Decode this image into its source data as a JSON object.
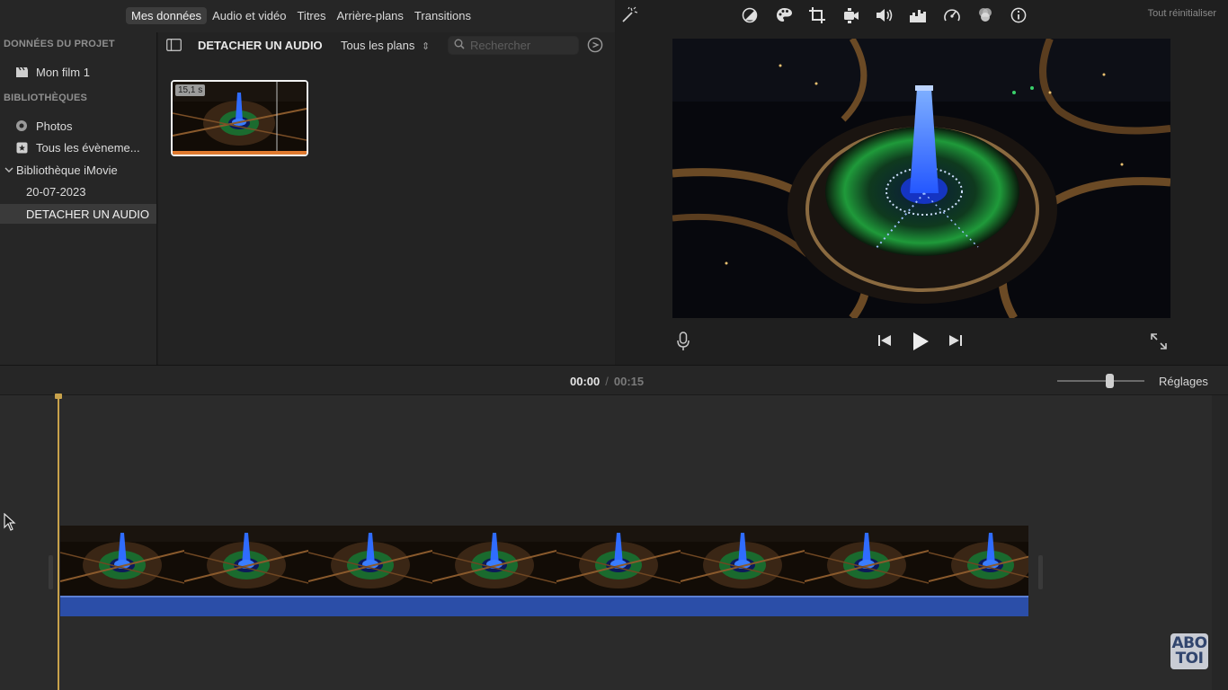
{
  "top_tabs": [
    {
      "label": "Mes données",
      "active": true
    },
    {
      "label": "Audio et vidéo",
      "active": false
    },
    {
      "label": "Titres",
      "active": false
    },
    {
      "label": "Arrière-plans",
      "active": false
    },
    {
      "label": "Transitions",
      "active": false
    }
  ],
  "sidebar": {
    "project_header": "DONNÉES DU PROJET",
    "project_item": {
      "label": "Mon film 1",
      "icon": "clapperboard-icon"
    },
    "libraries_header": "BIBLIOTHÈQUES",
    "items": [
      {
        "label": "Photos",
        "icon": "photos-icon"
      },
      {
        "label": "Tous les évèneme...",
        "icon": "star-icon"
      },
      {
        "label": "Bibliothèque iMovie",
        "icon": "chevron-down-icon"
      },
      {
        "label": "20-07-2023"
      },
      {
        "label": "DETACHER UN AUDIO",
        "selected": true
      }
    ]
  },
  "browser": {
    "title": "DETACHER UN AUDIO",
    "filter": "Tous les plans",
    "search_placeholder": "Rechercher",
    "clip": {
      "duration_badge": "15,1 s"
    }
  },
  "viewer": {
    "toolbar_icons": [
      "magic-wand-icon",
      "color-balance-icon",
      "color-palette-icon",
      "crop-icon",
      "camera-stabilize-icon",
      "volume-icon",
      "equalizer-icon",
      "speed-icon",
      "filter-icon",
      "info-icon"
    ],
    "reset_label": "Tout réinitialiser"
  },
  "timeline": {
    "current_time": "00:00",
    "separator": "/",
    "total_time": "00:15",
    "zoom_level": 0.6,
    "settings_label": "Réglages"
  },
  "watermark": {
    "line1": "ABO",
    "line2": "TOI"
  },
  "colors": {
    "accent_orange": "#e07a2f",
    "audio_blue": "#2b4ea8",
    "playhead": "#c8a24b"
  }
}
